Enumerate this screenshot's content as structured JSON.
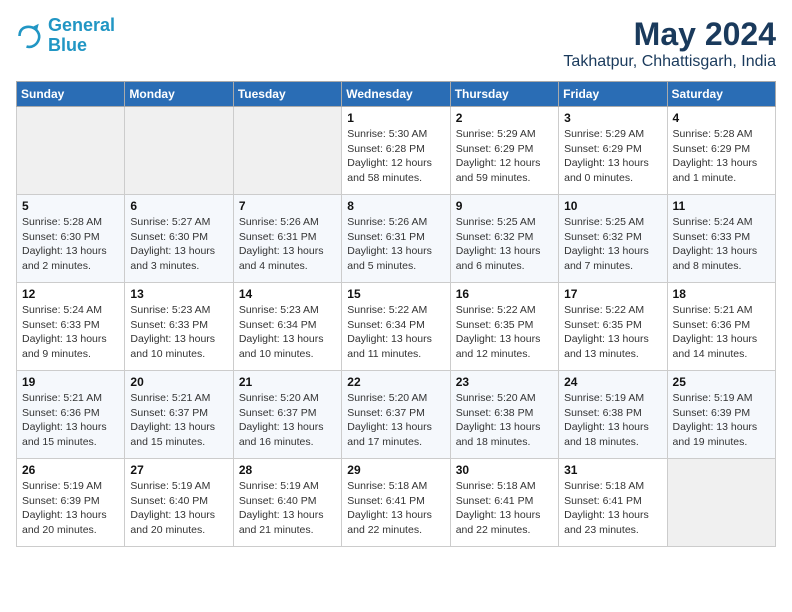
{
  "logo": {
    "line1": "General",
    "line2": "Blue"
  },
  "title": "May 2024",
  "subtitle": "Takhatpur, Chhattisgarh, India",
  "weekdays": [
    "Sunday",
    "Monday",
    "Tuesday",
    "Wednesday",
    "Thursday",
    "Friday",
    "Saturday"
  ],
  "weeks": [
    [
      {
        "day": "",
        "info": ""
      },
      {
        "day": "",
        "info": ""
      },
      {
        "day": "",
        "info": ""
      },
      {
        "day": "1",
        "info": "Sunrise: 5:30 AM\nSunset: 6:28 PM\nDaylight: 12 hours\nand 58 minutes."
      },
      {
        "day": "2",
        "info": "Sunrise: 5:29 AM\nSunset: 6:29 PM\nDaylight: 12 hours\nand 59 minutes."
      },
      {
        "day": "3",
        "info": "Sunrise: 5:29 AM\nSunset: 6:29 PM\nDaylight: 13 hours\nand 0 minutes."
      },
      {
        "day": "4",
        "info": "Sunrise: 5:28 AM\nSunset: 6:29 PM\nDaylight: 13 hours\nand 1 minute."
      }
    ],
    [
      {
        "day": "5",
        "info": "Sunrise: 5:28 AM\nSunset: 6:30 PM\nDaylight: 13 hours\nand 2 minutes."
      },
      {
        "day": "6",
        "info": "Sunrise: 5:27 AM\nSunset: 6:30 PM\nDaylight: 13 hours\nand 3 minutes."
      },
      {
        "day": "7",
        "info": "Sunrise: 5:26 AM\nSunset: 6:31 PM\nDaylight: 13 hours\nand 4 minutes."
      },
      {
        "day": "8",
        "info": "Sunrise: 5:26 AM\nSunset: 6:31 PM\nDaylight: 13 hours\nand 5 minutes."
      },
      {
        "day": "9",
        "info": "Sunrise: 5:25 AM\nSunset: 6:32 PM\nDaylight: 13 hours\nand 6 minutes."
      },
      {
        "day": "10",
        "info": "Sunrise: 5:25 AM\nSunset: 6:32 PM\nDaylight: 13 hours\nand 7 minutes."
      },
      {
        "day": "11",
        "info": "Sunrise: 5:24 AM\nSunset: 6:33 PM\nDaylight: 13 hours\nand 8 minutes."
      }
    ],
    [
      {
        "day": "12",
        "info": "Sunrise: 5:24 AM\nSunset: 6:33 PM\nDaylight: 13 hours\nand 9 minutes."
      },
      {
        "day": "13",
        "info": "Sunrise: 5:23 AM\nSunset: 6:33 PM\nDaylight: 13 hours\nand 10 minutes."
      },
      {
        "day": "14",
        "info": "Sunrise: 5:23 AM\nSunset: 6:34 PM\nDaylight: 13 hours\nand 10 minutes."
      },
      {
        "day": "15",
        "info": "Sunrise: 5:22 AM\nSunset: 6:34 PM\nDaylight: 13 hours\nand 11 minutes."
      },
      {
        "day": "16",
        "info": "Sunrise: 5:22 AM\nSunset: 6:35 PM\nDaylight: 13 hours\nand 12 minutes."
      },
      {
        "day": "17",
        "info": "Sunrise: 5:22 AM\nSunset: 6:35 PM\nDaylight: 13 hours\nand 13 minutes."
      },
      {
        "day": "18",
        "info": "Sunrise: 5:21 AM\nSunset: 6:36 PM\nDaylight: 13 hours\nand 14 minutes."
      }
    ],
    [
      {
        "day": "19",
        "info": "Sunrise: 5:21 AM\nSunset: 6:36 PM\nDaylight: 13 hours\nand 15 minutes."
      },
      {
        "day": "20",
        "info": "Sunrise: 5:21 AM\nSunset: 6:37 PM\nDaylight: 13 hours\nand 15 minutes."
      },
      {
        "day": "21",
        "info": "Sunrise: 5:20 AM\nSunset: 6:37 PM\nDaylight: 13 hours\nand 16 minutes."
      },
      {
        "day": "22",
        "info": "Sunrise: 5:20 AM\nSunset: 6:37 PM\nDaylight: 13 hours\nand 17 minutes."
      },
      {
        "day": "23",
        "info": "Sunrise: 5:20 AM\nSunset: 6:38 PM\nDaylight: 13 hours\nand 18 minutes."
      },
      {
        "day": "24",
        "info": "Sunrise: 5:19 AM\nSunset: 6:38 PM\nDaylight: 13 hours\nand 18 minutes."
      },
      {
        "day": "25",
        "info": "Sunrise: 5:19 AM\nSunset: 6:39 PM\nDaylight: 13 hours\nand 19 minutes."
      }
    ],
    [
      {
        "day": "26",
        "info": "Sunrise: 5:19 AM\nSunset: 6:39 PM\nDaylight: 13 hours\nand 20 minutes."
      },
      {
        "day": "27",
        "info": "Sunrise: 5:19 AM\nSunset: 6:40 PM\nDaylight: 13 hours\nand 20 minutes."
      },
      {
        "day": "28",
        "info": "Sunrise: 5:19 AM\nSunset: 6:40 PM\nDaylight: 13 hours\nand 21 minutes."
      },
      {
        "day": "29",
        "info": "Sunrise: 5:18 AM\nSunset: 6:41 PM\nDaylight: 13 hours\nand 22 minutes."
      },
      {
        "day": "30",
        "info": "Sunrise: 5:18 AM\nSunset: 6:41 PM\nDaylight: 13 hours\nand 22 minutes."
      },
      {
        "day": "31",
        "info": "Sunrise: 5:18 AM\nSunset: 6:41 PM\nDaylight: 13 hours\nand 23 minutes."
      },
      {
        "day": "",
        "info": ""
      }
    ]
  ]
}
